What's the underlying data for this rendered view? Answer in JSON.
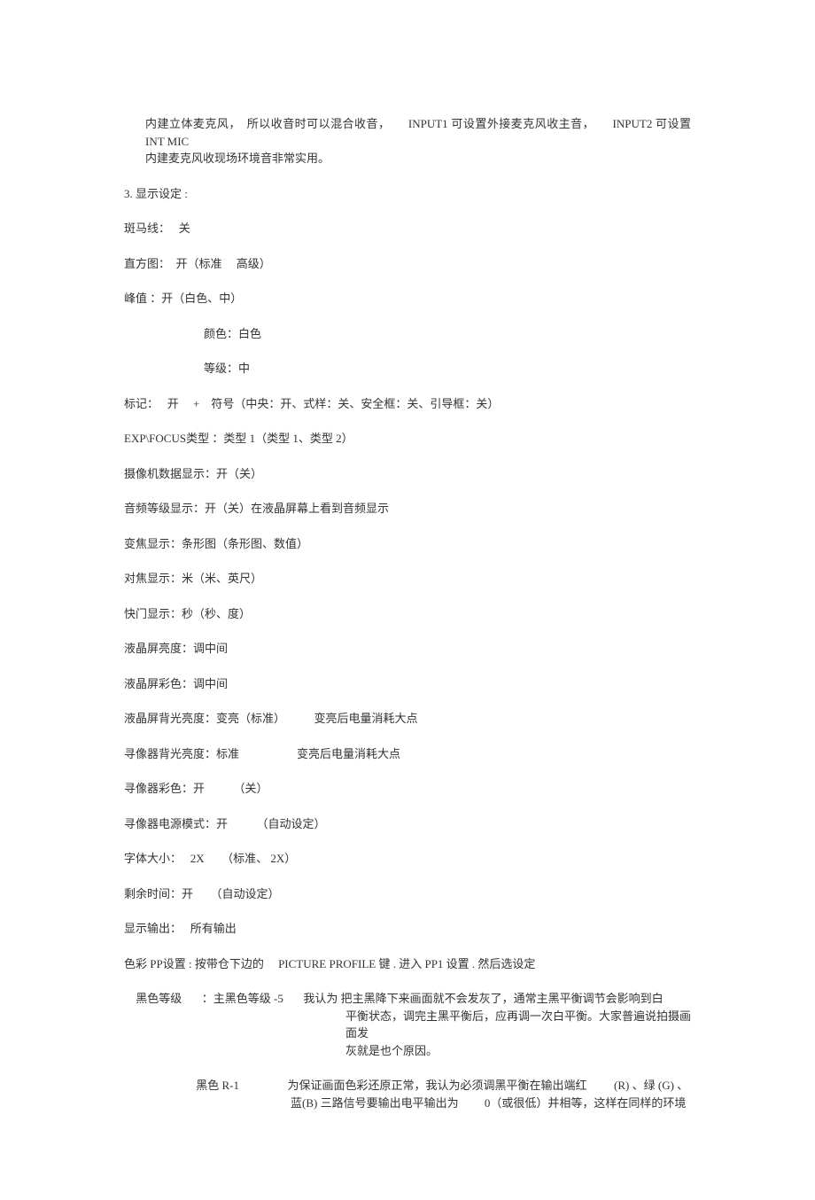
{
  "intro": {
    "p1": "内建立体麦克风，　所以收音时可以混合收音，　　INPUT1  可设置外接麦克风收主音，　　INPUT2  可设置  INT MIC",
    "p2": "内建麦克风收现场环境音非常实用。"
  },
  "section3_title": "3. 显示设定  :",
  "zebra": "斑马线：　 关",
  "histogram": "直方图：　开（标准 　高级）",
  "peak": "峰值  ：开（白色、中）",
  "peak_color": "颜色：白色",
  "peak_level": "等级：中",
  "marker": "标记：　 开　 +　符号（中央：开、式样：关、安全框：关、引导框：关）",
  "exptype": "EXP\\FOCUS类型  ：类型  1（类型  1、类型  2）",
  "camdata": "摄像机数据显示：开（关）",
  "audio": "音频等级显示：开（关）在液晶屏幕上看到音频显示",
  "zoom": "变焦显示：条形图（条形图、数值）",
  "focus": "对焦显示：米（米、英尺）",
  "shutter": "快门显示：秒（秒、度）",
  "lcdbright": "液晶屏亮度：调中间",
  "lcdcolor": "液晶屏彩色：调中间",
  "lcdbacklight": "液晶屏背光亮度：变亮（标准）　　　变亮后电量消耗大点",
  "vfbacklight": "寻像器背光亮度：标准　　　　　变亮后电量消耗大点",
  "vfcolor": "寻像器彩色：开　　　（关）",
  "vfpower": "寻像器电源模式：开　　　（自动设定）",
  "fontsize": "字体大小：　 2X　　（标准、 2X）",
  "remaining": "剩余时间：开　　（自动设定）",
  "dispout": "显示输出：　 所有输出",
  "pp_intro": "色彩  PP设置 : 按带仓下边的 　PICTURE PROFILE 键 . 进入  PP1 设置 . 然后选设定",
  "black_level": {
    "label": "黑色等级",
    "value": "：主黑色等级   -5",
    "line1": "我认为   把主黑降下来画面就不会发灰了，通常主黑平衡调节会影响到白",
    "line2": "平衡状态，调完主黑平衡后，应再调一次白平衡。大家普遍说拍摄画面发",
    "line3": "灰就是也个原因。"
  },
  "black_r": {
    "label": "黑色  R-1",
    "line1_a": "为保证画面色彩还原正常，我认为必须调黑平衡在输出端红",
    "line1_b": "(R) 、绿 (G) 、",
    "line2": "蓝(B) 三路信号要输出电平输出为　　 0（或很低）并相等，这样在同样的环境"
  }
}
